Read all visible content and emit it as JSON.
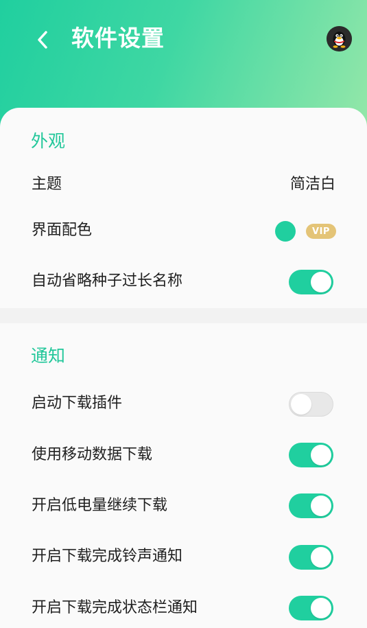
{
  "header": {
    "title": "软件设置",
    "back_icon": "chevron-left-icon",
    "avatar_icon": "qq-penguin-icon",
    "gradient_start": "#20cf9f",
    "gradient_end": "#95e7a9"
  },
  "appearance": {
    "section_title": "外观",
    "theme_label": "主题",
    "theme_value": "简洁白",
    "color_label": "界面配色",
    "color_value": "#20cf9f",
    "vip_label": "VIP",
    "truncate_label": "自动省略种子过长名称",
    "truncate_on": true
  },
  "notification": {
    "section_title": "通知",
    "items": [
      {
        "label": "启动下载插件",
        "on": false
      },
      {
        "label": "使用移动数据下载",
        "on": true
      },
      {
        "label": "开启低电量继续下载",
        "on": true
      },
      {
        "label": "开启下载完成铃声通知",
        "on": true
      },
      {
        "label": "开启下载完成状态栏通知",
        "on": true
      }
    ]
  },
  "colors": {
    "accent": "#20cf9f",
    "vip_gold": "#e4c477",
    "toggle_off": "#e8e8e8"
  }
}
